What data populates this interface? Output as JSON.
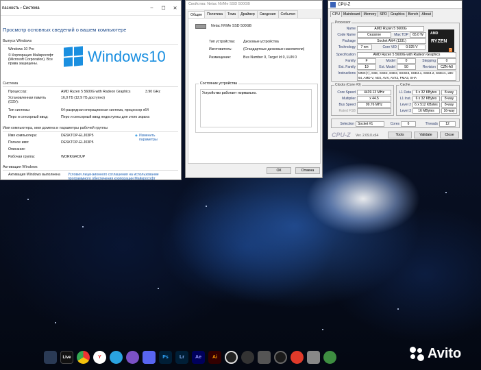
{
  "system_window": {
    "titlebar": "пасность  ›  Система",
    "heading": "Просмотр основных сведений о вашем компьютере",
    "edition_section": "Выпуск Windows",
    "edition": "Windows 10 Pro",
    "copyright": "© Корпорация Майкрософт (Microsoft Corporation). Все права защищены.",
    "logo_text": "Windows10",
    "system_section": "Система",
    "rows": [
      {
        "label": "Процессор:",
        "value": "AMD Ryzen 5 5600G with Radeon Graphics",
        "extra": "3.90 GHz"
      },
      {
        "label": "Установленная память (ОЗУ):",
        "value": "16,0 ГБ (12,9 ГБ доступно)"
      },
      {
        "label": "Тип системы:",
        "value": "64-разрядная операционная система, процессор x64"
      },
      {
        "label": "Перо и сенсорный ввод:",
        "value": "Перо и сенсорный ввод недоступны для этого экрана"
      }
    ],
    "name_section": "Имя компьютера, имя домена и параметры рабочей группы",
    "name_rows": [
      {
        "label": "Имя компьютера:",
        "value": "DESKTOP-ELJ03P5"
      },
      {
        "label": "Полное имя:",
        "value": "DESKTOP-ELJ03P5"
      },
      {
        "label": "Описание:",
        "value": ""
      },
      {
        "label": "Рабочая группа:",
        "value": "WORKGROUP"
      }
    ],
    "change_link": "Изменить параметры",
    "activation_section": "Активация Windows",
    "activation_label": "Активация Windows выполнена",
    "activation_link": "Условия лицензионного соглашения на использование программного обеспечения корпорации Майкрософт"
  },
  "props_window": {
    "title": "Свойства: Netac NVMe SSD 500GB",
    "tabs": [
      "Общие",
      "Политика",
      "Тома",
      "Драйвер",
      "Сведения",
      "События"
    ],
    "device_name": "Netac NVMe SSD 500GB",
    "rows": [
      {
        "label": "Тип устройства:",
        "value": "Дисковые устройства"
      },
      {
        "label": "Изготовитель:",
        "value": "(Стандартные дисковые накопители)"
      },
      {
        "label": "Размещение:",
        "value": "Bus Number 0, Target Id 0, LUN 0"
      }
    ],
    "status_group": "Состояние устройства",
    "status_text": "Устройство работает нормально.",
    "ok": "ОК",
    "cancel": "Отмена"
  },
  "cpuz": {
    "title": "CPU-Z",
    "tabs": [
      "CPU",
      "Mainboard",
      "Memory",
      "SPD",
      "Graphics",
      "Bench",
      "About"
    ],
    "processor_group": "Processor",
    "name": "AMD Ryzen 5 5600G",
    "code_name": "Cezanne",
    "max_tdp": "65.0 W",
    "package": "Socket AM4 (1331)",
    "technology": "7 nm",
    "core_voltage": "0.925 V",
    "specification": "AMD Ryzen 5 5600G with Radeon Graphics",
    "family": "F",
    "model": "0",
    "stepping": "0",
    "ext_family": "19",
    "ext_model": "50",
    "revision": "CZN-A0",
    "instructions": "MMX(+), SSE, SSE2, SSE3, SSSE3, SSE4.1, SSE4.2, SSE4A, x86-64, AMD-V, AES, AVX, AVX2, FMA3, SHA",
    "clocks_group": "Clocks (Core #0)",
    "core_speed": "4439.13 MHz",
    "multiplier": "x 44.5",
    "bus_speed": "99.76 MHz",
    "rated_fsb": "",
    "cache_group": "Cache",
    "l1_data": "6 x 32 KBytes",
    "l1_data_way": "8-way",
    "l1_inst": "6 x 32 KBytes",
    "l1_inst_way": "8-way",
    "level2": "6 x 512 KBytes",
    "level2_way": "8-way",
    "level3": "16 MBytes",
    "level3_way": "16-way",
    "selection": "Socket #1",
    "cores": "6",
    "threads": "12",
    "version": "Ver. 2.09.0.x64",
    "tools": "Tools",
    "validate": "Validate",
    "close": "Close",
    "logo_brand": "AMD",
    "logo_model": "RYZEN",
    "logo_num": "5",
    "labels": {
      "name": "Name",
      "code_name": "Code Name",
      "max_tdp": "Max TDP",
      "package": "Package",
      "technology": "Technology",
      "core_voltage": "Core VID",
      "specification": "Specification",
      "family": "Family",
      "model": "Model",
      "stepping": "Stepping",
      "ext_family": "Ext. Family",
      "ext_model": "Ext. Model",
      "revision": "Revision",
      "instructions": "Instructions",
      "core_speed": "Core Speed",
      "multiplier": "Multiplier",
      "bus_speed": "Bus Speed",
      "rated_fsb": "Rated FSB",
      "l1_data": "L1 Data",
      "l1_inst": "L1 Inst.",
      "level2": "Level 2",
      "level3": "Level 3",
      "selection": "Selection",
      "cores": "Cores",
      "threads": "Threads",
      "footer_logo": "CPU-Z"
    }
  },
  "dock_apps": [
    "",
    "Live",
    "",
    "Y",
    "",
    "",
    "",
    "Ps",
    "Lr",
    "Ae",
    "Ai",
    "",
    "",
    "",
    "",
    "",
    "",
    ""
  ],
  "watermark": "Avito"
}
